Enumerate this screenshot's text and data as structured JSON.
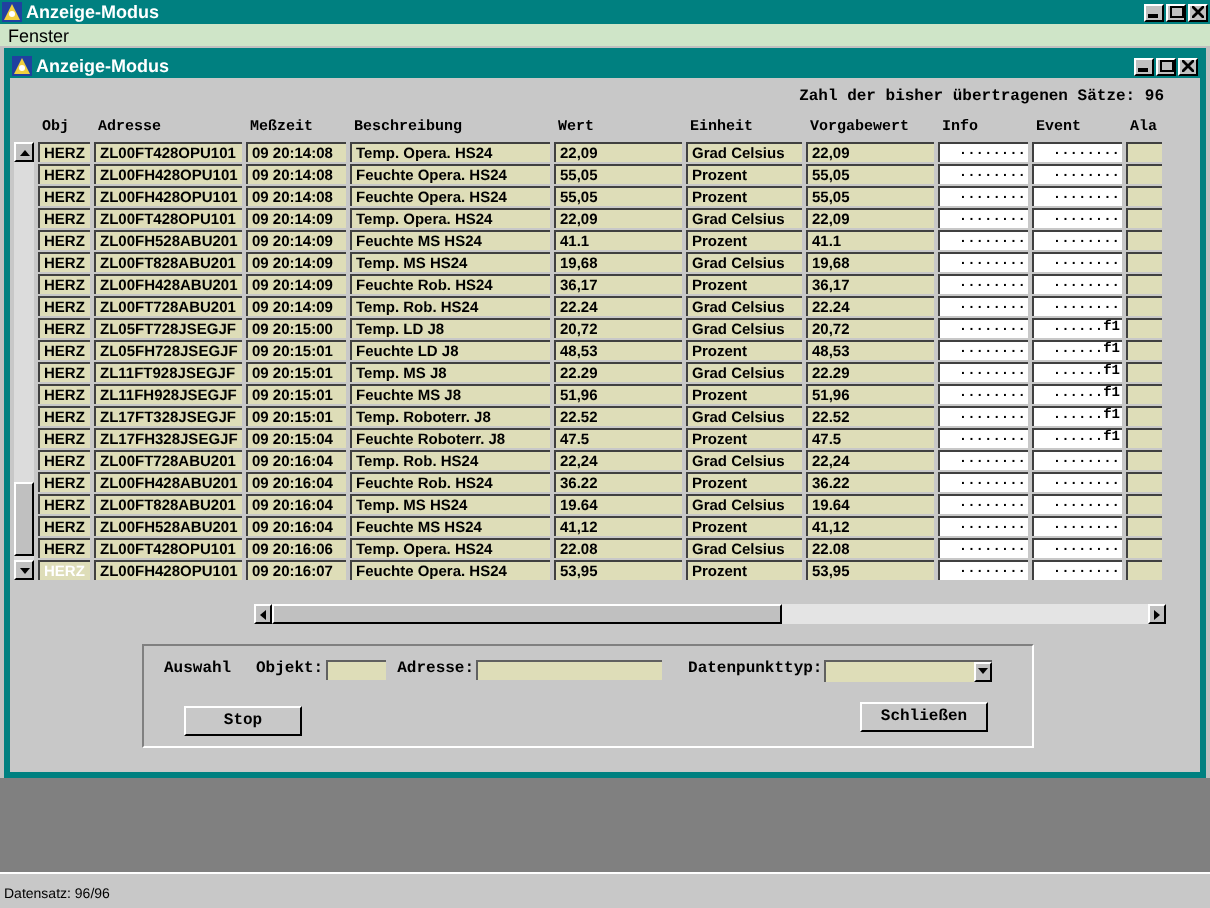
{
  "window": {
    "title": "Anzeige-Modus"
  },
  "menu": [
    "Fenster"
  ],
  "child_window": {
    "title": "Anzeige-Modus",
    "summary": "Zahl der bisher übertragenen Sätze: 96",
    "table": {
      "columns": [
        "Obj",
        "Adresse",
        "Meßzeit",
        "Beschreibung",
        "Wert",
        "Einheit",
        "Vorgabewert",
        "Info",
        "Event",
        "Ala"
      ],
      "rows": [
        {
          "obj": "HERZ",
          "adresse": "ZL00FT428OPU101",
          "messzeit": "09 20:14:08",
          "beschreibung": "Temp. Opera. HS24",
          "wert": "22,09",
          "einheit": "Grad Celsius",
          "vorgabewert": "22,09",
          "info": "........",
          "event": "........",
          "selected": false
        },
        {
          "obj": "HERZ",
          "adresse": "ZL00FH428OPU101",
          "messzeit": "09 20:14:08",
          "beschreibung": "Feuchte Opera. HS24",
          "wert": "55,05",
          "einheit": "Prozent",
          "vorgabewert": "55,05",
          "info": "........",
          "event": "........",
          "selected": false
        },
        {
          "obj": "HERZ",
          "adresse": "ZL00FH428OPU101",
          "messzeit": "09 20:14:08",
          "beschreibung": "Feuchte Opera. HS24",
          "wert": "55,05",
          "einheit": "Prozent",
          "vorgabewert": "55,05",
          "info": "........",
          "event": "........",
          "selected": false
        },
        {
          "obj": "HERZ",
          "adresse": "ZL00FT428OPU101",
          "messzeit": "09 20:14:09",
          "beschreibung": "Temp. Opera. HS24",
          "wert": "22,09",
          "einheit": "Grad Celsius",
          "vorgabewert": "22,09",
          "info": "........",
          "event": "........",
          "selected": false
        },
        {
          "obj": "HERZ",
          "adresse": "ZL00FH528ABU201",
          "messzeit": "09 20:14:09",
          "beschreibung": "Feuchte MS HS24",
          "wert": "41.1",
          "einheit": "Prozent",
          "vorgabewert": "41.1",
          "info": "........",
          "event": "........",
          "selected": false
        },
        {
          "obj": "HERZ",
          "adresse": "ZL00FT828ABU201",
          "messzeit": "09 20:14:09",
          "beschreibung": "Temp. MS HS24",
          "wert": "19,68",
          "einheit": "Grad Celsius",
          "vorgabewert": "19,68",
          "info": "........",
          "event": "........",
          "selected": false
        },
        {
          "obj": "HERZ",
          "adresse": "ZL00FH428ABU201",
          "messzeit": "09 20:14:09",
          "beschreibung": "Feuchte Rob. HS24",
          "wert": "36,17",
          "einheit": "Prozent",
          "vorgabewert": "36,17",
          "info": "........",
          "event": "........",
          "selected": false
        },
        {
          "obj": "HERZ",
          "adresse": "ZL00FT728ABU201",
          "messzeit": "09 20:14:09",
          "beschreibung": "Temp. Rob. HS24",
          "wert": "22.24",
          "einheit": "Grad Celsius",
          "vorgabewert": "22.24",
          "info": "........",
          "event": "........",
          "selected": false
        },
        {
          "obj": "HERZ",
          "adresse": "ZL05FT728JSEGJF",
          "messzeit": "09 20:15:00",
          "beschreibung": "Temp. LD J8",
          "wert": "20,72",
          "einheit": "Grad Celsius",
          "vorgabewert": "20,72",
          "info": "........",
          "event": "......f1",
          "selected": false
        },
        {
          "obj": "HERZ",
          "adresse": "ZL05FH728JSEGJF",
          "messzeit": "09 20:15:01",
          "beschreibung": "Feuchte LD J8",
          "wert": "48,53",
          "einheit": "Prozent",
          "vorgabewert": "48,53",
          "info": "........",
          "event": "......f1",
          "selected": false
        },
        {
          "obj": "HERZ",
          "adresse": "ZL11FT928JSEGJF",
          "messzeit": "09 20:15:01",
          "beschreibung": "Temp. MS J8",
          "wert": "22.29",
          "einheit": "Grad Celsius",
          "vorgabewert": "22.29",
          "info": "........",
          "event": "......f1",
          "selected": false
        },
        {
          "obj": "HERZ",
          "adresse": "ZL11FH928JSEGJF",
          "messzeit": "09 20:15:01",
          "beschreibung": "Feuchte MS J8",
          "wert": "51,96",
          "einheit": "Prozent",
          "vorgabewert": "51,96",
          "info": "........",
          "event": "......f1",
          "selected": false
        },
        {
          "obj": "HERZ",
          "adresse": "ZL17FT328JSEGJF",
          "messzeit": "09 20:15:01",
          "beschreibung": "Temp. Roboterr. J8",
          "wert": "22.52",
          "einheit": "Grad Celsius",
          "vorgabewert": "22.52",
          "info": "........",
          "event": "......f1",
          "selected": false
        },
        {
          "obj": "HERZ",
          "adresse": "ZL17FH328JSEGJF",
          "messzeit": "09 20:15:04",
          "beschreibung": "Feuchte Roboterr. J8",
          "wert": "47.5",
          "einheit": "Prozent",
          "vorgabewert": "47.5",
          "info": "........",
          "event": "......f1",
          "selected": false
        },
        {
          "obj": "HERZ",
          "adresse": "ZL00FT728ABU201",
          "messzeit": "09 20:16:04",
          "beschreibung": "Temp. Rob. HS24",
          "wert": "22,24",
          "einheit": "Grad Celsius",
          "vorgabewert": "22,24",
          "info": "........",
          "event": "........",
          "selected": false
        },
        {
          "obj": "HERZ",
          "adresse": "ZL00FH428ABU201",
          "messzeit": "09 20:16:04",
          "beschreibung": "Feuchte Rob. HS24",
          "wert": "36.22",
          "einheit": "Prozent",
          "vorgabewert": "36.22",
          "info": "........",
          "event": "........",
          "selected": false
        },
        {
          "obj": "HERZ",
          "adresse": "ZL00FT828ABU201",
          "messzeit": "09 20:16:04",
          "beschreibung": "Temp. MS HS24",
          "wert": "19.64",
          "einheit": "Grad Celsius",
          "vorgabewert": "19.64",
          "info": "........",
          "event": "........",
          "selected": false
        },
        {
          "obj": "HERZ",
          "adresse": "ZL00FH528ABU201",
          "messzeit": "09 20:16:04",
          "beschreibung": "Feuchte MS HS24",
          "wert": "41,12",
          "einheit": "Prozent",
          "vorgabewert": "41,12",
          "info": "........",
          "event": "........",
          "selected": false
        },
        {
          "obj": "HERZ",
          "adresse": "ZL00FT428OPU101",
          "messzeit": "09 20:16:06",
          "beschreibung": "Temp. Opera. HS24",
          "wert": "22.08",
          "einheit": "Grad Celsius",
          "vorgabewert": "22.08",
          "info": "........",
          "event": "........",
          "selected": false
        },
        {
          "obj": "HERZ",
          "adresse": "ZL00FH428OPU101",
          "messzeit": "09 20:16:07",
          "beschreibung": "Feuchte Opera. HS24",
          "wert": "53,95",
          "einheit": "Prozent",
          "vorgabewert": "53,95",
          "info": "........",
          "event": "........",
          "selected": true
        }
      ]
    }
  },
  "filter": {
    "title": "Auswahl",
    "objekt": {
      "label": "Objekt:"
    },
    "adresse": {
      "label": "Adresse:"
    },
    "datenpunkttyp": {
      "label": "Datenpunkttyp:"
    },
    "buttons": [
      "Stop",
      "Schließen"
    ]
  },
  "status_bar": "Datensatz: 96/96"
}
